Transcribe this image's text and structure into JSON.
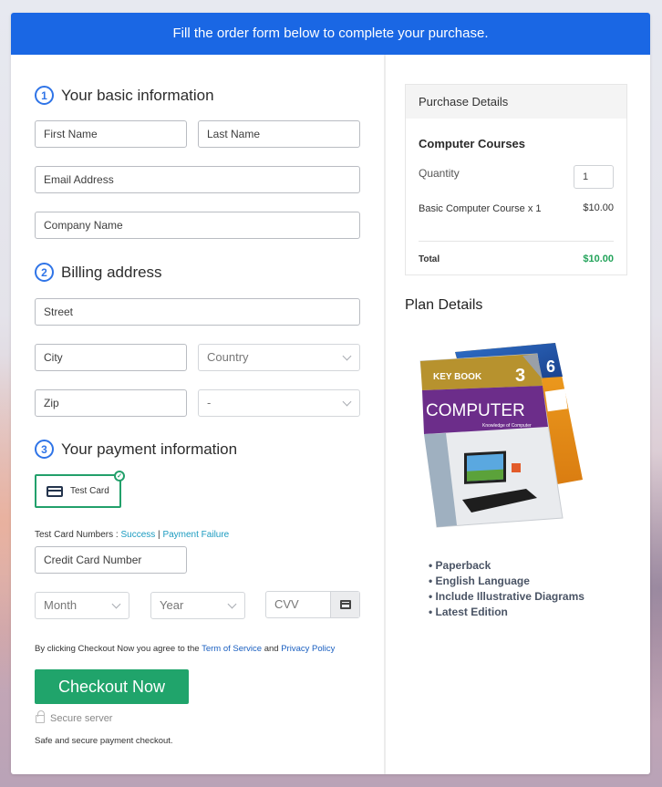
{
  "banner": {
    "text": "Fill the order form below to complete your purchase."
  },
  "sections": {
    "basic": {
      "step": "1",
      "title": "Your basic information"
    },
    "billing": {
      "step": "2",
      "title": "Billing address"
    },
    "payment": {
      "step": "3",
      "title": "Your payment information"
    }
  },
  "fields": {
    "first_name": "First Name",
    "last_name": "Last Name",
    "email": "Email Address",
    "company": "Company Name",
    "street": "Street",
    "city": "City",
    "country": "Country",
    "zip": "Zip",
    "state": "-",
    "card_number": "Credit Card Number",
    "month": "Month",
    "year": "Year",
    "cvv": "CVV"
  },
  "payment": {
    "method_label": "Test Card",
    "test_numbers_label": "Test Card Numbers : ",
    "success_link": "Success",
    "separator": " | ",
    "failure_link": "Payment Failure"
  },
  "terms": {
    "prefix": "By clicking Checkout Now you agree to the ",
    "tos_link": "Term of Service",
    "and": " and ",
    "privacy_link": "Privacy Policy"
  },
  "checkout": {
    "button_label": "Checkout Now",
    "secure_label": "Secure server",
    "safe_text": "Safe and secure payment checkout."
  },
  "purchase": {
    "header": "Purchase Details",
    "product": "Computer Courses",
    "quantity_label": "Quantity",
    "quantity_value": "1",
    "line_item": "Basic Computer Course x 1",
    "line_price": "$10.00",
    "total_label": "Total",
    "total_value": "$10.00"
  },
  "plan": {
    "title": "Plan Details",
    "book_front": {
      "brand": "KEY BOOK",
      "number": "3",
      "title": "COMPUTER",
      "subtitle": "Knowledge of Computer"
    },
    "book_back": {
      "number": "6"
    },
    "features": [
      "Paperback",
      "English Language",
      "Include Illustrative Diagrams",
      "Latest Edition"
    ]
  },
  "colors": {
    "banner": "#1a67e4",
    "accent_green": "#20a46b",
    "step_blue": "#2f74e7",
    "link_teal": "#1b9bc0"
  }
}
